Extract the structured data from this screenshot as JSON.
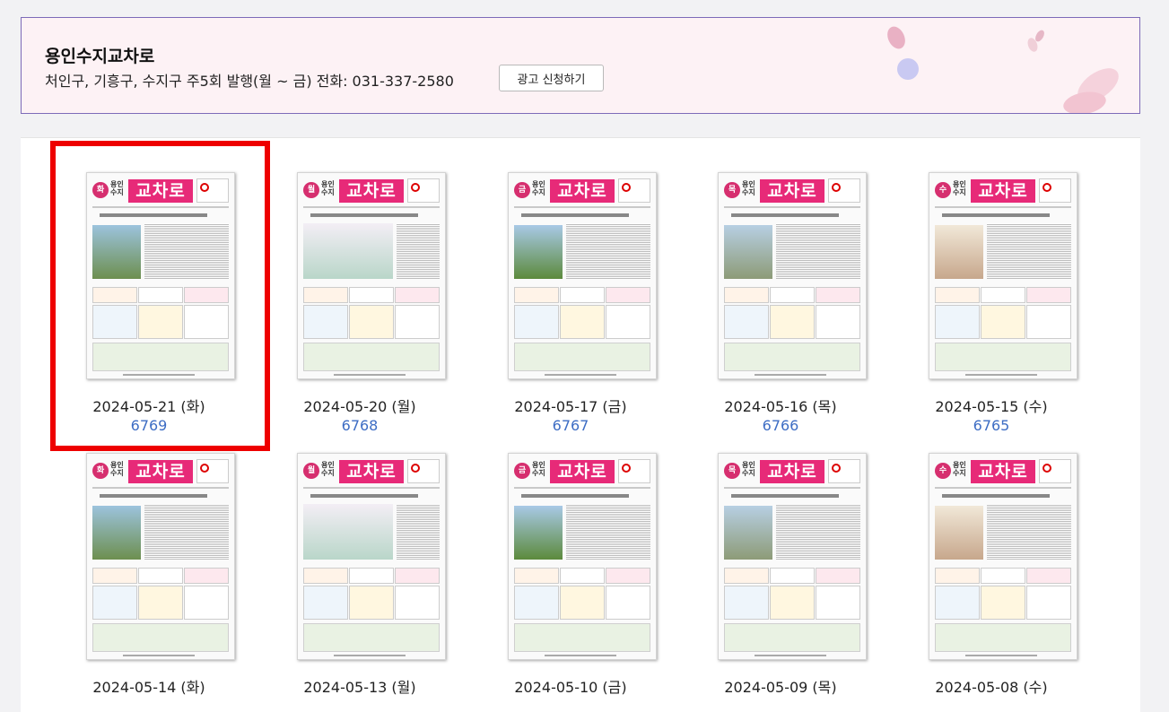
{
  "header": {
    "title": "용인수지교차로",
    "description": "처인구, 기흥구, 수지구 주5회 발행(월 ~ 금) 전화: 031-337-2580",
    "ad_button": "광고 신청하기"
  },
  "thumbnail_text": {
    "logo": "교차로",
    "region": "용인\n수지"
  },
  "issues": [
    {
      "date": "2024-05-21 (화)",
      "number": "6769",
      "day": "화",
      "selected": true
    },
    {
      "date": "2024-05-20 (월)",
      "number": "6768",
      "day": "월"
    },
    {
      "date": "2024-05-17 (금)",
      "number": "6767",
      "day": "금"
    },
    {
      "date": "2024-05-16 (목)",
      "number": "6766",
      "day": "목"
    },
    {
      "date": "2024-05-15 (수)",
      "number": "6765",
      "day": "수"
    },
    {
      "date": "2024-05-14 (화)",
      "number": "",
      "day": "화"
    },
    {
      "date": "2024-05-13 (월)",
      "number": "",
      "day": "월"
    },
    {
      "date": "2024-05-10 (금)",
      "number": "",
      "day": "금"
    },
    {
      "date": "2024-05-09 (목)",
      "number": "",
      "day": "목"
    },
    {
      "date": "2024-05-08 (수)",
      "number": "",
      "day": "수"
    }
  ],
  "colors": {
    "accent": "#e72a78",
    "link": "#3d6dc4",
    "highlight": "#ee0000",
    "header_bg": "#fdf2f5"
  }
}
